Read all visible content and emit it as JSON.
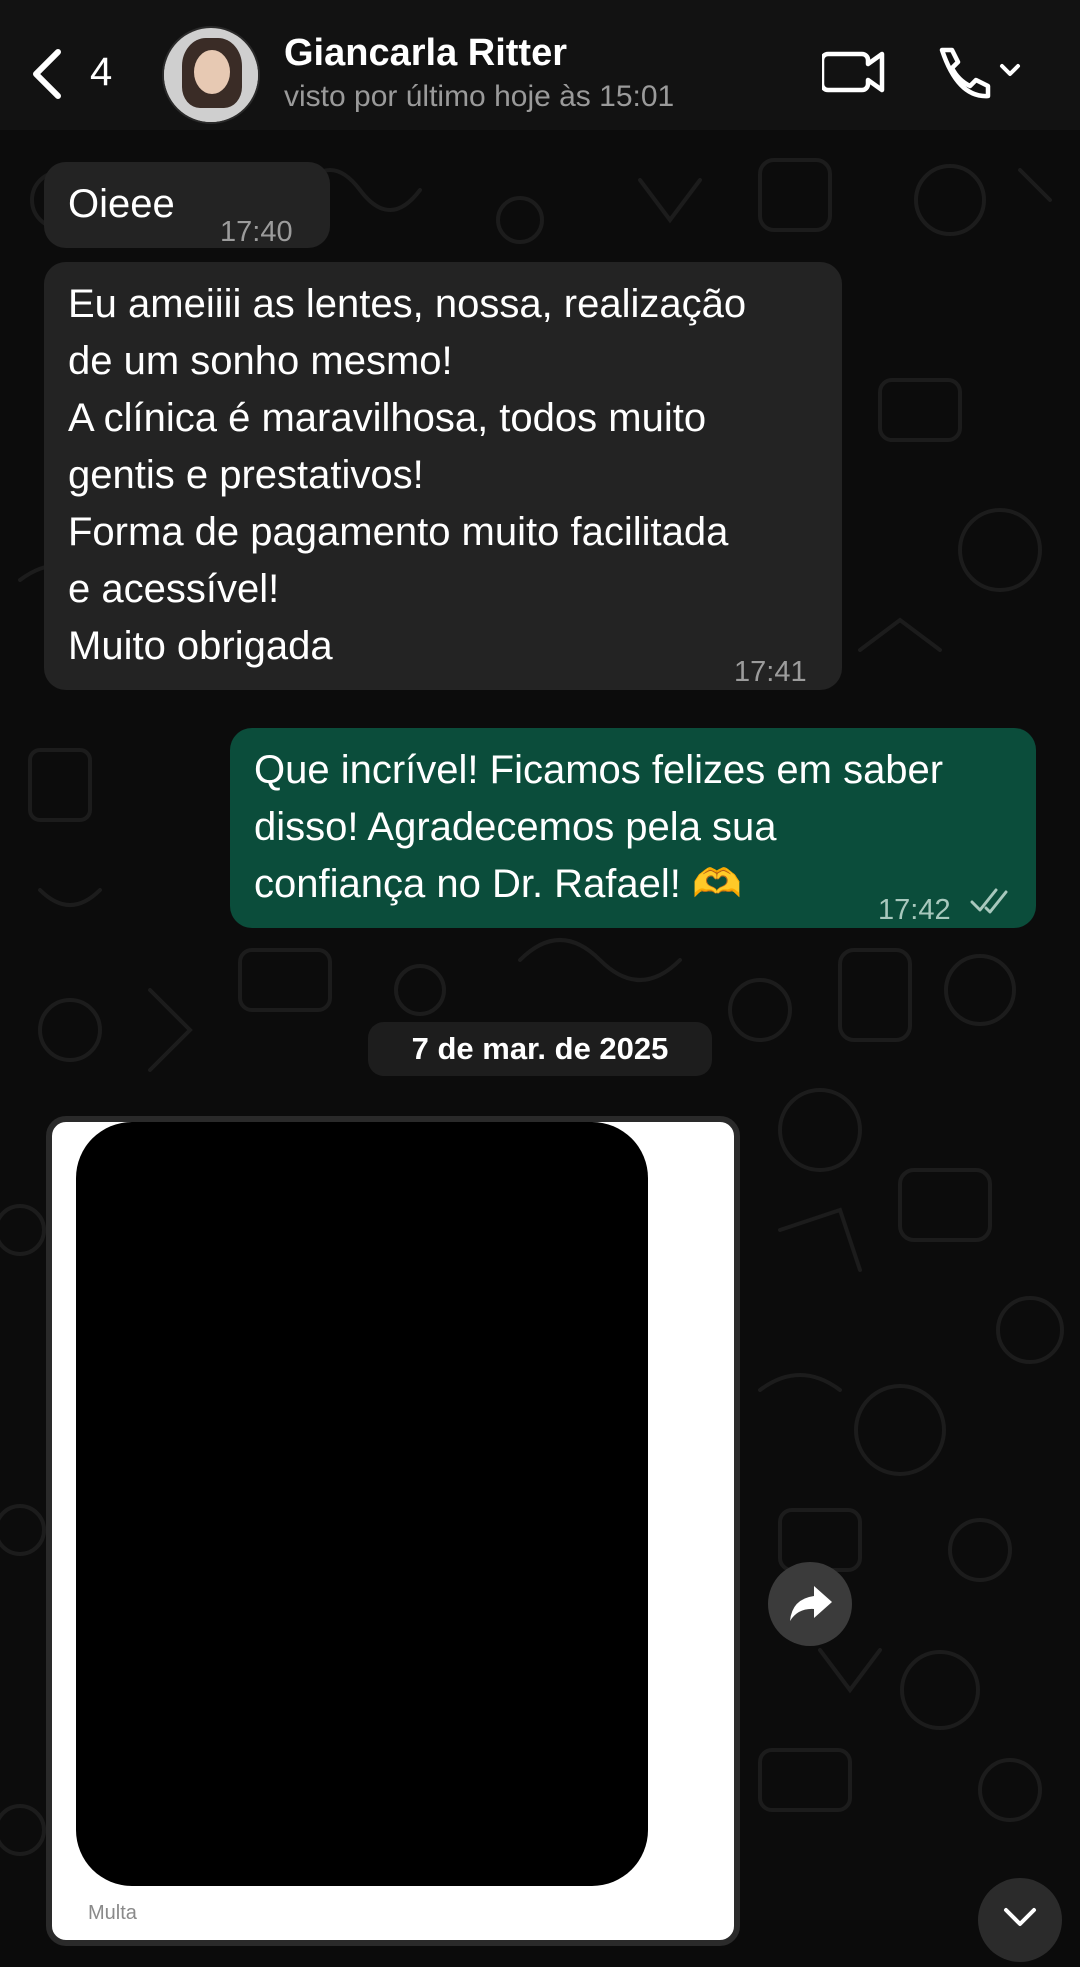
{
  "header": {
    "back_count": "4",
    "contact_name": "Giancarla Ritter",
    "status": "visto por último hoje às 15:01",
    "icons": [
      "back-chevron-icon",
      "video-call-icon",
      "phone-call-icon",
      "chevron-down-icon"
    ]
  },
  "messages": [
    {
      "direction": "incoming",
      "text": "Oieee",
      "time": "17:40"
    },
    {
      "direction": "incoming",
      "lines": [
        "Eu ameiiii as lentes, nossa, realização",
        "de um sonho mesmo!",
        "A clínica é maravilhosa, todos muito",
        "gentis e prestativos!",
        "Forma de pagamento muito facilitada",
        "e acessível!",
        "Muito obrigada"
      ],
      "time": "17:41"
    },
    {
      "direction": "outgoing",
      "lines": [
        "Que incrível! Ficamos felizes em saber",
        "disso! Agradecemos pela sua",
        "confiança no Dr. Rafael! 🫶"
      ],
      "time": "17:42",
      "read": true
    }
  ],
  "date_separator": "7 de mar. de 2025",
  "media": {
    "caption": "Multa"
  },
  "colors": {
    "incoming": "#232323",
    "outgoing": "#0b4d3b",
    "background": "#0c0c0c",
    "header": "#121212"
  }
}
